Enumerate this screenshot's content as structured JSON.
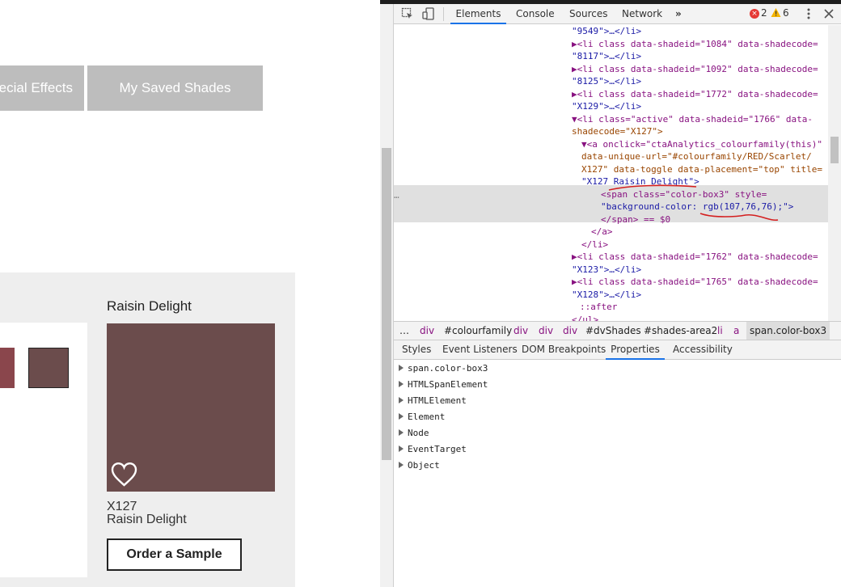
{
  "page": {
    "tabs": [
      {
        "label": "Special Effects"
      },
      {
        "label": "My Saved Shades"
      }
    ],
    "shade": {
      "title": "Raisin Delight",
      "code": "X127",
      "name": "Raisin Delight",
      "swatch_color": "#6b4c4c",
      "order_button": "Order a Sample",
      "heart_icon": "heart-outline-icon"
    },
    "mini_swatches": [
      {
        "color": "#8a464c"
      },
      {
        "color": "#6b4c4c"
      }
    ]
  },
  "devtools": {
    "toolbar": {
      "tabs": [
        "Elements",
        "Console",
        "Sources",
        "Network"
      ],
      "active_tab": "Elements",
      "more_icon": "chevron-double-right-icon",
      "errors": "2",
      "warnings": "6",
      "kebab_icon": "vertical-dots-icon",
      "close_icon": "close-icon",
      "inspect_icon": "inspect-element-icon",
      "device_icon": "device-toggle-icon"
    },
    "elements_lines": [
      {
        "indent": 0,
        "text": "\"9549\">…</li>"
      },
      {
        "indent": 0,
        "text": "▶<li class data-shadeid=\"1084\" data-shadecode="
      },
      {
        "indent": 0,
        "text": "\"8117\">…</li>"
      },
      {
        "indent": 0,
        "text": "▶<li class data-shadeid=\"1092\" data-shadecode="
      },
      {
        "indent": 0,
        "text": "\"8125\">…</li>"
      },
      {
        "indent": 0,
        "text": "▶<li class data-shadeid=\"1772\" data-shadecode="
      },
      {
        "indent": 0,
        "text": "\"X129\">…</li>"
      },
      {
        "indent": 0,
        "text": "▼<li class=\"active\" data-shadeid=\"1766\" data-"
      },
      {
        "indent": 0,
        "text": "shadecode=\"X127\">"
      },
      {
        "indent": 1,
        "text": "▼<a onclick=\"ctaAnalytics_colourfamily(this)\""
      },
      {
        "indent": 1,
        "text": "data-unique-url=\"#colourfamily/RED/Scarlet/"
      },
      {
        "indent": 1,
        "text": "X127\" data-toggle data-placement=\"top\" title="
      },
      {
        "indent": 1,
        "text": "\"X127 Raisin Delight\">"
      },
      {
        "indent": 2,
        "text": "<span class=\"color-box3\" style="
      },
      {
        "indent": 2,
        "text": "\"background-color: rgb(107,76,76);\">"
      },
      {
        "indent": 2,
        "text": "</span> == $0"
      },
      {
        "indent": 1,
        "text": "</a>"
      },
      {
        "indent": 0,
        "text": "</li>"
      },
      {
        "indent": 0,
        "text": "▶<li class data-shadeid=\"1762\" data-shadecode="
      },
      {
        "indent": 0,
        "text": "\"X123\">…</li>"
      },
      {
        "indent": 0,
        "text": "▶<li class data-shadeid=\"1765\" data-shadecode="
      },
      {
        "indent": 0,
        "text": "\"X128\">…</li>"
      },
      {
        "indent": 0,
        "text": "::after"
      },
      {
        "indent": 0,
        "text": "</ul>"
      }
    ],
    "selected_dots": "…",
    "breadcrumbs": [
      "…",
      "div",
      "#colourfamily",
      "div",
      "div",
      "div",
      "#dvShades",
      "#shades-area2",
      "li",
      "a",
      "span.color-box3"
    ],
    "subtabs": [
      "Styles",
      "Event Listeners",
      "DOM Breakpoints",
      "Properties",
      "Accessibility"
    ],
    "active_subtab": "Properties",
    "properties": [
      "span.color-box3",
      "HTMLSpanElement",
      "HTMLElement",
      "Element",
      "Node",
      "EventTarget",
      "Object"
    ]
  }
}
